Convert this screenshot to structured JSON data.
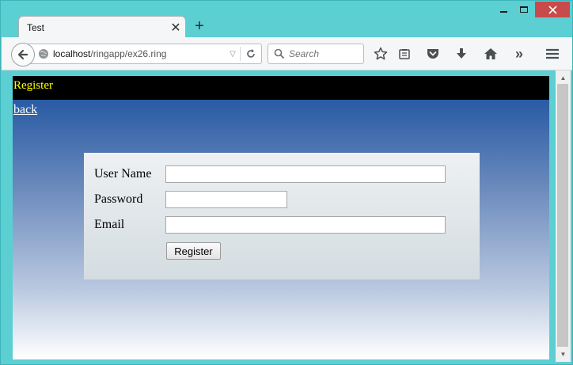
{
  "browser": {
    "tab_title": "Test",
    "tab_close_glyph": "✕",
    "new_tab_glyph": "+",
    "url_host": "localhost",
    "url_path": "/ringapp/ex26.ring",
    "search_placeholder": "Search",
    "overflow_glyph": "»"
  },
  "page": {
    "header_title": "Register",
    "back_link": "back",
    "form": {
      "username_label": "User Name",
      "password_label": "Password",
      "email_label": "Email",
      "username_value": "",
      "password_value": "",
      "email_value": "",
      "submit_label": "Register"
    }
  },
  "icons": {
    "back": "back-arrow-icon",
    "globe": "globe-icon",
    "reload": "reload-icon",
    "search": "search-icon",
    "bookmark": "star-icon",
    "reading_list": "clipboard-icon",
    "pocket": "pocket-icon",
    "download": "download-icon",
    "home": "home-icon",
    "menu": "hamburger-menu-icon"
  },
  "colors": {
    "header_background": "#000000",
    "header_text": "#ffff00",
    "window_frame": "#5ccfd3",
    "close_button": "#c94a4a"
  }
}
